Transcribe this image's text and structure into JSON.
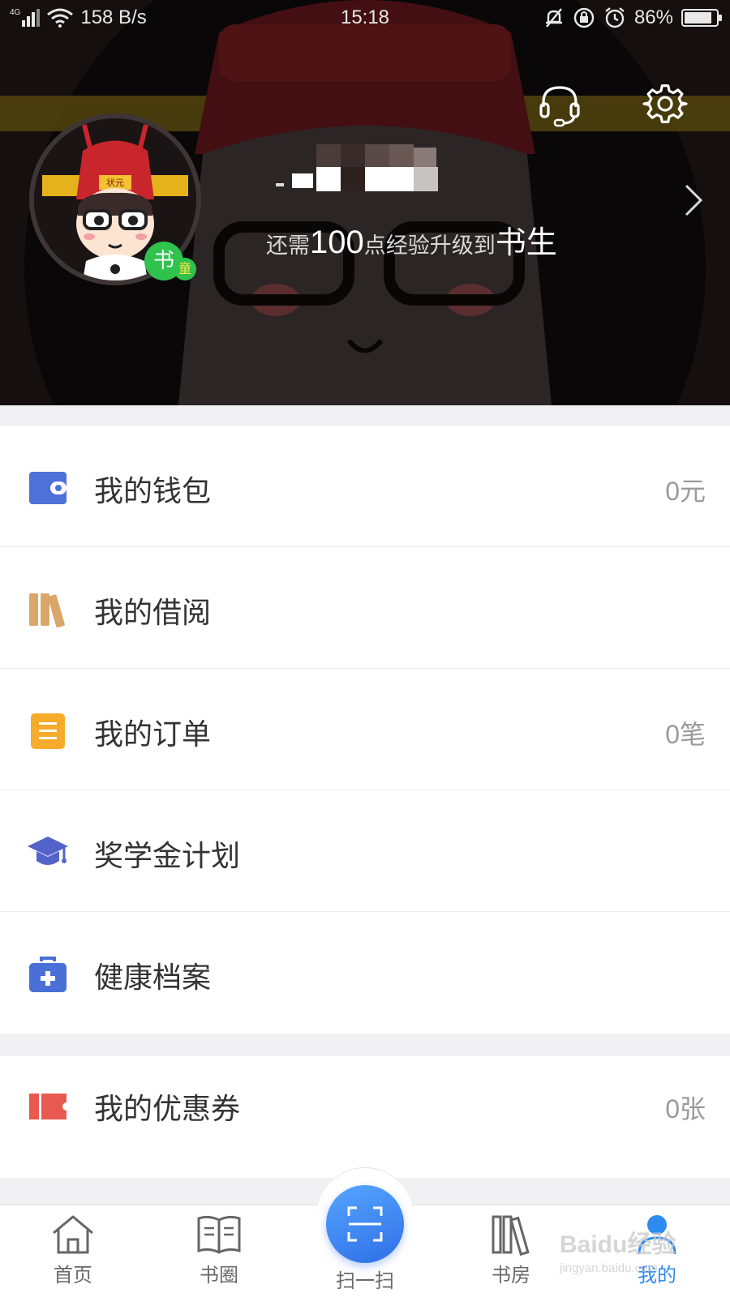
{
  "status_bar": {
    "network": "4G",
    "speed": "158 B/s",
    "time": "15:18",
    "battery": "86%",
    "battery_level": 0.86
  },
  "profile": {
    "exp_prefix": "还需",
    "exp_points": "100",
    "exp_middle": "点经验升级到",
    "next_level": "书生",
    "level_badge": "书",
    "level_badge_sub": "童",
    "avatar_hat_text": "状元"
  },
  "menu_group_1": [
    {
      "label": "我的钱包",
      "value": "0元",
      "icon": "wallet-icon",
      "color": "#4f6fd9"
    },
    {
      "label": "我的借阅",
      "value": "",
      "icon": "books-icon",
      "color": "#d9a76a"
    },
    {
      "label": "我的订单",
      "value": "0笔",
      "icon": "order-icon",
      "color": "#f7ab2b"
    },
    {
      "label": "奖学金计划",
      "value": "",
      "icon": "graduation-cap-icon",
      "color": "#5363c9"
    },
    {
      "label": "健康档案",
      "value": "",
      "icon": "medical-kit-icon",
      "color": "#4a6fd6"
    }
  ],
  "menu_group_2": [
    {
      "label": "我的优惠券",
      "value": "0张",
      "icon": "coupon-icon",
      "color": "#e85a4f"
    }
  ],
  "bottom_nav": {
    "home": "首页",
    "circle": "书圈",
    "scan": "扫一扫",
    "shelf": "书房",
    "mine": "我的"
  },
  "watermark": {
    "brand": "Baidu经验",
    "url": "jingyan.baidu.com"
  }
}
